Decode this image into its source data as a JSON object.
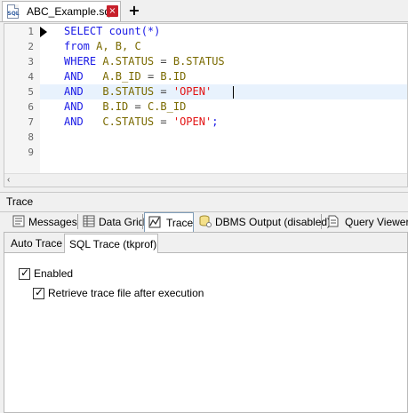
{
  "document_tabs": [
    {
      "label": "ABC_Example.sql",
      "icon": "sql-file-icon",
      "icon_text": "SQL",
      "close_glyph": "×"
    }
  ],
  "new_tab_glyph": "+",
  "editor": {
    "current_line": 5,
    "lines": [
      {
        "num": "1",
        "tokens": [
          {
            "t": "SELECT ",
            "c": "kw"
          },
          {
            "t": "count(*)",
            "c": "kw"
          }
        ]
      },
      {
        "num": "2",
        "tokens": [
          {
            "t": "from ",
            "c": "kw"
          },
          {
            "t": "A, B, C",
            "c": "id"
          }
        ]
      },
      {
        "num": "3",
        "tokens": [
          {
            "t": "WHERE ",
            "c": "kw"
          },
          {
            "t": "A.STATUS",
            "c": "id"
          },
          {
            "t": " = ",
            "c": "op"
          },
          {
            "t": "B.STATUS",
            "c": "id"
          }
        ]
      },
      {
        "num": "4",
        "tokens": [
          {
            "t": "AND   ",
            "c": "kw"
          },
          {
            "t": "A.B_ID",
            "c": "id"
          },
          {
            "t": " = ",
            "c": "op"
          },
          {
            "t": "B.ID",
            "c": "id"
          }
        ]
      },
      {
        "num": "5",
        "tokens": [
          {
            "t": "AND   ",
            "c": "kw"
          },
          {
            "t": "B.STATUS",
            "c": "id"
          },
          {
            "t": " = ",
            "c": "op"
          },
          {
            "t": "'OPEN'",
            "c": "str"
          }
        ]
      },
      {
        "num": "6",
        "tokens": [
          {
            "t": "AND   ",
            "c": "kw"
          },
          {
            "t": "B.ID",
            "c": "id"
          },
          {
            "t": " = ",
            "c": "op"
          },
          {
            "t": "C.B_ID",
            "c": "id"
          }
        ]
      },
      {
        "num": "7",
        "tokens": [
          {
            "t": "AND   ",
            "c": "kw"
          },
          {
            "t": "C.STATUS",
            "c": "id"
          },
          {
            "t": " = ",
            "c": "op"
          },
          {
            "t": "'OPEN'",
            "c": "str"
          },
          {
            "t": ";",
            "c": "kw"
          }
        ]
      },
      {
        "num": "8",
        "tokens": []
      },
      {
        "num": "9",
        "tokens": []
      }
    ],
    "scroll_left_glyph": "‹"
  },
  "trace_panel": {
    "title": "Trace",
    "tabs": [
      {
        "label": "Messages",
        "icon": "messages-icon"
      },
      {
        "label": "Data Grid",
        "icon": "data-grid-icon"
      },
      {
        "label": "Trace",
        "icon": "trace-icon",
        "active": true
      },
      {
        "label": "DBMS Output (disabled)",
        "icon": "dbms-output-icon"
      },
      {
        "label": "Query Viewer",
        "icon": "query-viewer-icon"
      }
    ],
    "sub_tabs": [
      {
        "label": "Auto Trace"
      },
      {
        "label": "SQL Trace (tkprof)",
        "active": true
      }
    ],
    "options": {
      "enabled": {
        "label": "Enabled",
        "checked": true
      },
      "retrieve": {
        "label": "Retrieve trace file after execution",
        "checked": true
      }
    },
    "check_glyph": "✓"
  },
  "colors": {
    "keyword": "#1a1ae6",
    "identifier": "#7a6a00",
    "string": "#e31313",
    "close_button": "#c8202b",
    "current_line": "#e8f2fd"
  }
}
